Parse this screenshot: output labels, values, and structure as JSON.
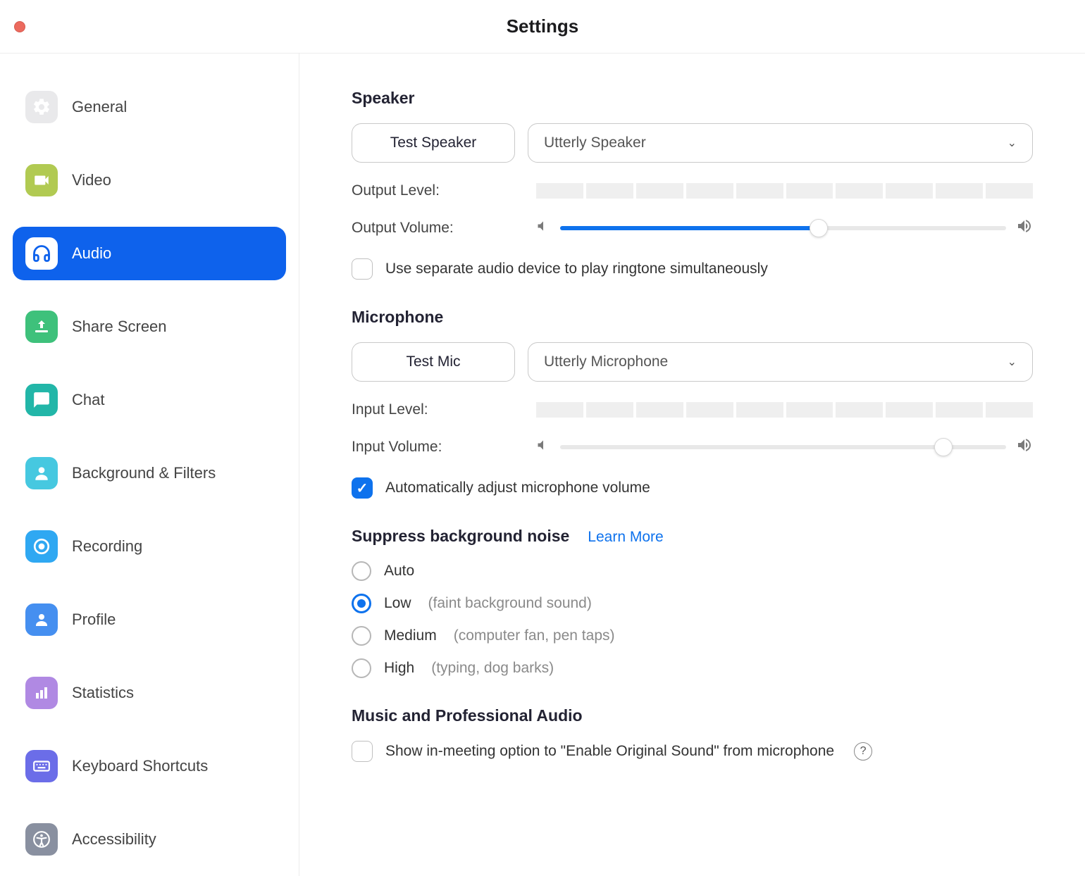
{
  "window": {
    "title": "Settings"
  },
  "sidebar": {
    "items": [
      {
        "label": "General"
      },
      {
        "label": "Video"
      },
      {
        "label": "Audio"
      },
      {
        "label": "Share Screen"
      },
      {
        "label": "Chat"
      },
      {
        "label": "Background & Filters"
      },
      {
        "label": "Recording"
      },
      {
        "label": "Profile"
      },
      {
        "label": "Statistics"
      },
      {
        "label": "Keyboard Shortcuts"
      },
      {
        "label": "Accessibility"
      }
    ]
  },
  "audio": {
    "speaker": {
      "heading": "Speaker",
      "test_button": "Test Speaker",
      "device": "Utterly Speaker",
      "output_level_label": "Output Level:",
      "output_volume_label": "Output Volume:",
      "output_volume_pct": 58,
      "separate_ringtone_label": "Use separate audio device to play ringtone simultaneously",
      "separate_ringtone_checked": false
    },
    "microphone": {
      "heading": "Microphone",
      "test_button": "Test Mic",
      "device": "Utterly Microphone",
      "input_level_label": "Input Level:",
      "input_volume_label": "Input Volume:",
      "input_volume_pct": 86,
      "auto_adjust_label": "Automatically adjust microphone volume",
      "auto_adjust_checked": true
    },
    "suppress": {
      "heading": "Suppress background noise",
      "learn_more": "Learn More",
      "selected": "low",
      "options": {
        "auto": {
          "label": "Auto",
          "hint": ""
        },
        "low": {
          "label": "Low",
          "hint": "(faint background sound)"
        },
        "medium": {
          "label": "Medium",
          "hint": "(computer fan, pen taps)"
        },
        "high": {
          "label": "High",
          "hint": "(typing, dog barks)"
        }
      }
    },
    "music": {
      "heading": "Music and Professional Audio",
      "show_original_sound_label": "Show in-meeting option to \"Enable Original Sound\" from microphone",
      "show_original_sound_checked": false
    }
  }
}
